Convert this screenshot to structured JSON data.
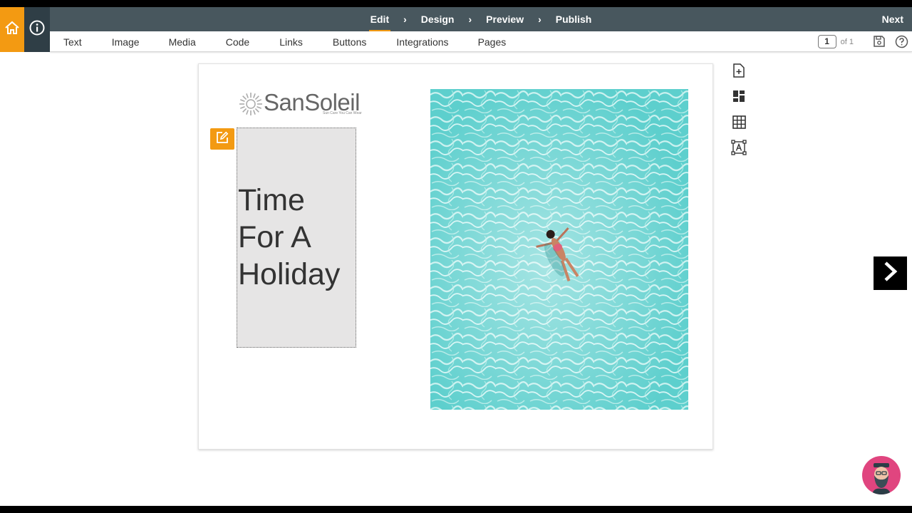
{
  "steps": {
    "edit": "Edit",
    "design": "Design",
    "preview": "Preview",
    "publish": "Publish",
    "separator": "›",
    "next": "Next"
  },
  "toolbar": {
    "items": [
      "Text",
      "Image",
      "Media",
      "Code",
      "Links",
      "Buttons",
      "Integrations",
      "Pages"
    ],
    "page_current": "1",
    "page_of": "of 1"
  },
  "canvas": {
    "logo_text": "SanSoleil",
    "logo_tagline": "Sun Care You Can Wear",
    "headline_lines": [
      "Time",
      "For A",
      "Holiday"
    ]
  },
  "icons": {
    "home": "home-icon",
    "info": "info-icon",
    "save": "save-icon",
    "help": "help-icon",
    "edit": "edit-icon",
    "add_page": "add-page-icon",
    "blocks": "blocks-icon",
    "grid": "grid-icon",
    "text_frame": "text-frame-icon",
    "next_arrow": "chevron-right-icon"
  },
  "colors": {
    "accent": "#f39a12",
    "stepbar": "#48575e",
    "info_bg": "#2f3e46",
    "text_block_bg": "#e6e5e5",
    "water": "#5fd0d0",
    "avatar_bg": "#e0457f"
  }
}
